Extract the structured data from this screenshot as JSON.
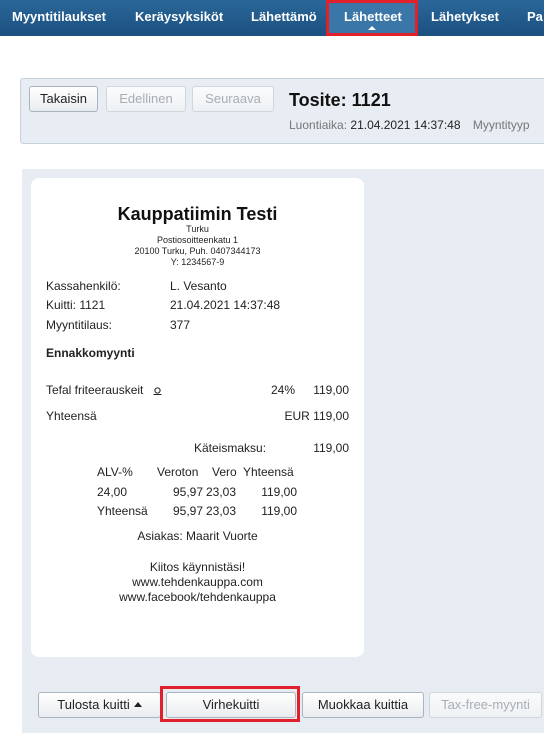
{
  "nav": {
    "tabs": [
      {
        "label": "Myyntitilaukset"
      },
      {
        "label": "Keräysyksiköt"
      },
      {
        "label": "Lähettämö"
      },
      {
        "label": "Lähetteet"
      },
      {
        "label": "Lähetykset"
      },
      {
        "label": "Pa"
      }
    ],
    "active_index": 3
  },
  "header": {
    "back_label": "Takaisin",
    "prev_label": "Edellinen",
    "next_label": "Seuraava",
    "title": "Tosite: 1121",
    "created_label": "Luontiaika:",
    "created_value": "21.04.2021 14:37:48",
    "sales_type_label": "Myyntityyp"
  },
  "receipt": {
    "shop_name": "Kauppatiimin Testi",
    "address": [
      "Turku",
      "Postiosoitteenkatu 1",
      "20100 Turku, Puh. 0407344173",
      "Y: 1234567-9"
    ],
    "cashier_label": "Kassahenkilö:",
    "cashier_value": "L. Vesanto",
    "receipt_label": "Kuitti: 1121",
    "receipt_datetime": "21.04.2021 14:37:48",
    "order_label": "Myyntitilaus:",
    "order_value": "377",
    "section_title": "Ennakkomyynti",
    "item": {
      "name": "Tefal friteerauskeit",
      "vat": "24%",
      "price": "119,00"
    },
    "total_label": "Yhteensä",
    "total_value": "EUR 119,00",
    "payment_label": "Käteismaksu:",
    "payment_value": "119,00",
    "vat_table": {
      "headers": [
        "ALV-%",
        "Veroton",
        "Vero",
        "Yhteensä"
      ],
      "rows": [
        [
          "24,00",
          "95,97",
          "23,03",
          "119,00"
        ],
        [
          "Yhteensä",
          "95,97",
          "23,03",
          "119,00"
        ]
      ]
    },
    "customer": "Asiakas: Maarit Vuorte",
    "thanks": "Kiitos käynnistäsi!",
    "web": "www.tehdenkauppa.com",
    "facebook": "www.facebook/tehdenkauppa"
  },
  "actions": {
    "print_label": "Tulosta kuitti",
    "error_label": "Virhekuitti",
    "edit_label": "Muokkaa kuittia",
    "taxfree_label": "Tax-free-myynti"
  },
  "colors": {
    "nav_bg": "#1f5a8a",
    "highlight_red": "#e0202a",
    "panel_bg": "#e6ecf1"
  }
}
